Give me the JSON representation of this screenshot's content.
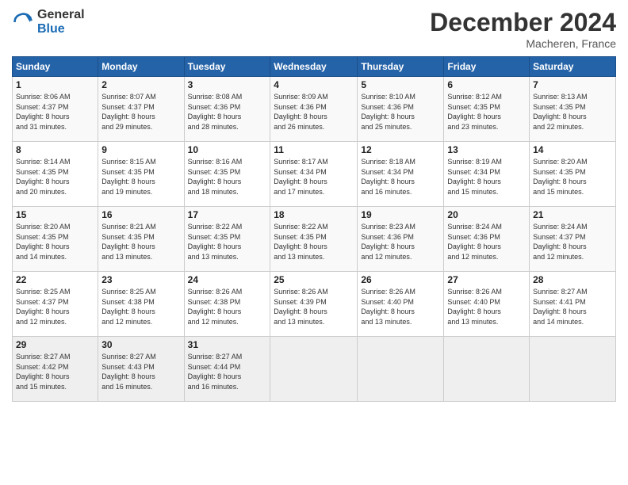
{
  "logo": {
    "general": "General",
    "blue": "Blue"
  },
  "title": "December 2024",
  "location": "Macheren, France",
  "header": {
    "days": [
      "Sunday",
      "Monday",
      "Tuesday",
      "Wednesday",
      "Thursday",
      "Friday",
      "Saturday"
    ]
  },
  "weeks": [
    [
      {
        "day": "1",
        "sunrise": "8:06 AM",
        "sunset": "4:37 PM",
        "daylight": "8 hours and 31 minutes."
      },
      {
        "day": "2",
        "sunrise": "8:07 AM",
        "sunset": "4:37 PM",
        "daylight": "8 hours and 29 minutes."
      },
      {
        "day": "3",
        "sunrise": "8:08 AM",
        "sunset": "4:36 PM",
        "daylight": "8 hours and 28 minutes."
      },
      {
        "day": "4",
        "sunrise": "8:09 AM",
        "sunset": "4:36 PM",
        "daylight": "8 hours and 26 minutes."
      },
      {
        "day": "5",
        "sunrise": "8:10 AM",
        "sunset": "4:36 PM",
        "daylight": "8 hours and 25 minutes."
      },
      {
        "day": "6",
        "sunrise": "8:12 AM",
        "sunset": "4:35 PM",
        "daylight": "8 hours and 23 minutes."
      },
      {
        "day": "7",
        "sunrise": "8:13 AM",
        "sunset": "4:35 PM",
        "daylight": "8 hours and 22 minutes."
      }
    ],
    [
      {
        "day": "8",
        "sunrise": "8:14 AM",
        "sunset": "4:35 PM",
        "daylight": "8 hours and 20 minutes."
      },
      {
        "day": "9",
        "sunrise": "8:15 AM",
        "sunset": "4:35 PM",
        "daylight": "8 hours and 19 minutes."
      },
      {
        "day": "10",
        "sunrise": "8:16 AM",
        "sunset": "4:35 PM",
        "daylight": "8 hours and 18 minutes."
      },
      {
        "day": "11",
        "sunrise": "8:17 AM",
        "sunset": "4:34 PM",
        "daylight": "8 hours and 17 minutes."
      },
      {
        "day": "12",
        "sunrise": "8:18 AM",
        "sunset": "4:34 PM",
        "daylight": "8 hours and 16 minutes."
      },
      {
        "day": "13",
        "sunrise": "8:19 AM",
        "sunset": "4:34 PM",
        "daylight": "8 hours and 15 minutes."
      },
      {
        "day": "14",
        "sunrise": "8:20 AM",
        "sunset": "4:35 PM",
        "daylight": "8 hours and 15 minutes."
      }
    ],
    [
      {
        "day": "15",
        "sunrise": "8:20 AM",
        "sunset": "4:35 PM",
        "daylight": "8 hours and 14 minutes."
      },
      {
        "day": "16",
        "sunrise": "8:21 AM",
        "sunset": "4:35 PM",
        "daylight": "8 hours and 13 minutes."
      },
      {
        "day": "17",
        "sunrise": "8:22 AM",
        "sunset": "4:35 PM",
        "daylight": "8 hours and 13 minutes."
      },
      {
        "day": "18",
        "sunrise": "8:22 AM",
        "sunset": "4:35 PM",
        "daylight": "8 hours and 13 minutes."
      },
      {
        "day": "19",
        "sunrise": "8:23 AM",
        "sunset": "4:36 PM",
        "daylight": "8 hours and 12 minutes."
      },
      {
        "day": "20",
        "sunrise": "8:24 AM",
        "sunset": "4:36 PM",
        "daylight": "8 hours and 12 minutes."
      },
      {
        "day": "21",
        "sunrise": "8:24 AM",
        "sunset": "4:37 PM",
        "daylight": "8 hours and 12 minutes."
      }
    ],
    [
      {
        "day": "22",
        "sunrise": "8:25 AM",
        "sunset": "4:37 PM",
        "daylight": "8 hours and 12 minutes."
      },
      {
        "day": "23",
        "sunrise": "8:25 AM",
        "sunset": "4:38 PM",
        "daylight": "8 hours and 12 minutes."
      },
      {
        "day": "24",
        "sunrise": "8:26 AM",
        "sunset": "4:38 PM",
        "daylight": "8 hours and 12 minutes."
      },
      {
        "day": "25",
        "sunrise": "8:26 AM",
        "sunset": "4:39 PM",
        "daylight": "8 hours and 13 minutes."
      },
      {
        "day": "26",
        "sunrise": "8:26 AM",
        "sunset": "4:40 PM",
        "daylight": "8 hours and 13 minutes."
      },
      {
        "day": "27",
        "sunrise": "8:26 AM",
        "sunset": "4:40 PM",
        "daylight": "8 hours and 13 minutes."
      },
      {
        "day": "28",
        "sunrise": "8:27 AM",
        "sunset": "4:41 PM",
        "daylight": "8 hours and 14 minutes."
      }
    ],
    [
      {
        "day": "29",
        "sunrise": "8:27 AM",
        "sunset": "4:42 PM",
        "daylight": "8 hours and 15 minutes."
      },
      {
        "day": "30",
        "sunrise": "8:27 AM",
        "sunset": "4:43 PM",
        "daylight": "8 hours and 16 minutes."
      },
      {
        "day": "31",
        "sunrise": "8:27 AM",
        "sunset": "4:44 PM",
        "daylight": "8 hours and 16 minutes."
      },
      null,
      null,
      null,
      null
    ]
  ],
  "labels": {
    "sunrise": "Sunrise:",
    "sunset": "Sunset:",
    "daylight": "Daylight:"
  }
}
